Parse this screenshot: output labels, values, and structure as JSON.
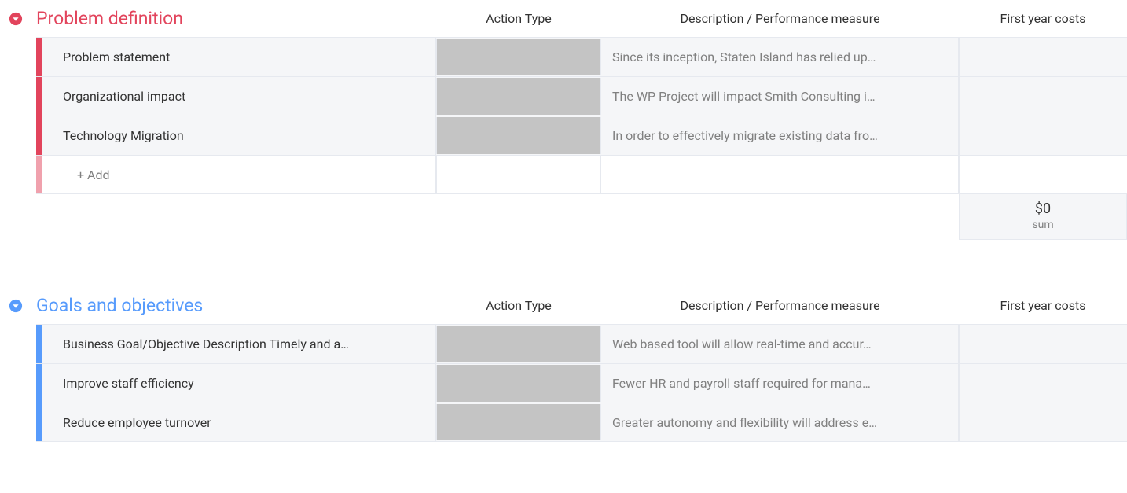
{
  "columns": {
    "action_type": "Action Type",
    "description": "Description / Performance measure",
    "first_year_costs": "First year costs"
  },
  "add_label": "+ Add",
  "sections": [
    {
      "id": "problem-definition",
      "title": "Problem definition",
      "color": "red",
      "rows": [
        {
          "label": "Problem statement",
          "description": "Since its inception, Staten Island has relied up…"
        },
        {
          "label": "Organizational impact",
          "description": "The WP Project will impact Smith Consulting i…"
        },
        {
          "label": "Technology Migration",
          "description": "In order to effectively migrate existing data fro…"
        }
      ],
      "summary": {
        "value": "$0",
        "label": "sum"
      }
    },
    {
      "id": "goals-and-objectives",
      "title": "Goals and objectives",
      "color": "blue",
      "rows": [
        {
          "label": "Business Goal/Objective Description Timely and a…",
          "description": "Web based tool will allow real-time and accur…"
        },
        {
          "label": "Improve staff efficiency",
          "description": "Fewer HR and payroll staff required for mana…"
        },
        {
          "label": "Reduce employee turnover",
          "description": "Greater autonomy and flexibility will address e…"
        }
      ]
    }
  ]
}
